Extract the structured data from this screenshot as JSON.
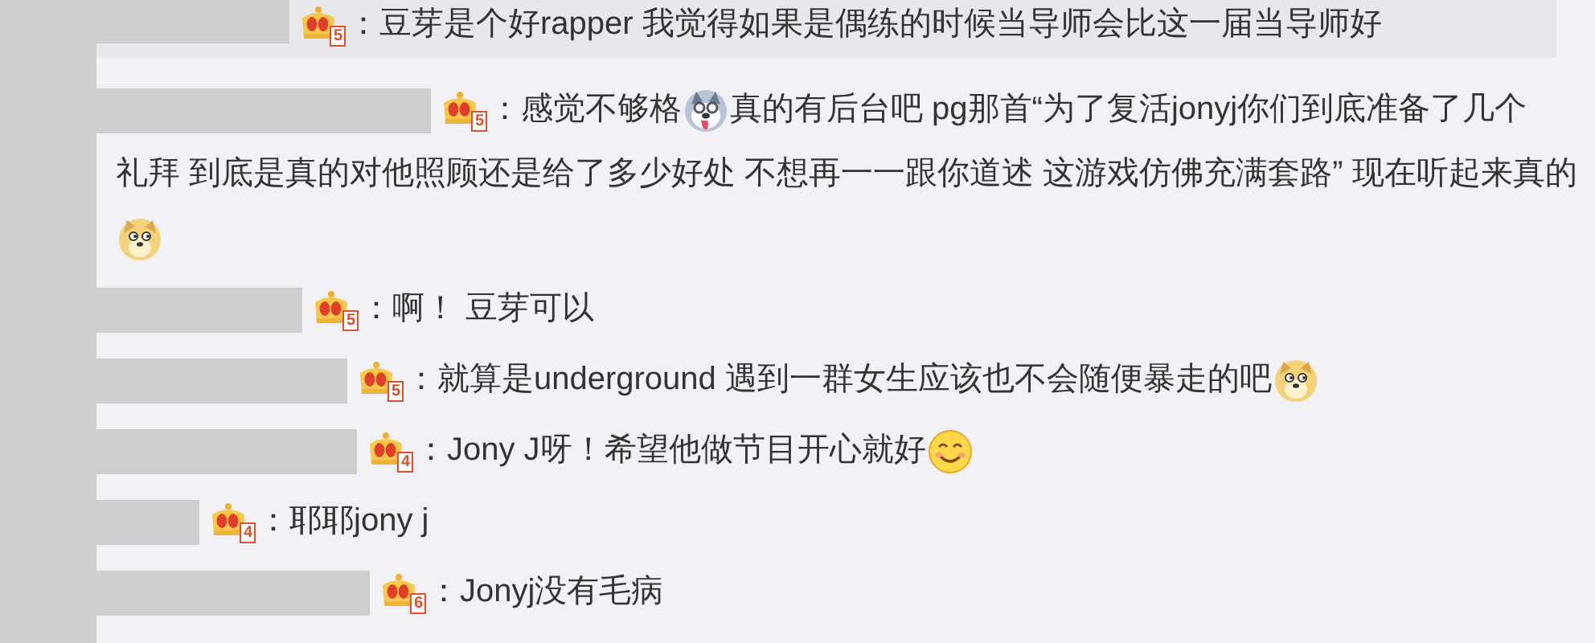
{
  "comments": [
    {
      "level": "5",
      "highlighted": true,
      "segments": [
        {
          "kind": "text",
          "text": "：豆芽是个好rapper  我觉得如果是偶练的时候当导师会比这一届当导师好"
        }
      ]
    },
    {
      "level": "5",
      "highlighted": false,
      "segments": [
        {
          "kind": "text",
          "text": "：感觉不够格"
        },
        {
          "kind": "husky"
        },
        {
          "kind": "text",
          "text": "真的有后台吧 pg那首“为了复活jonyj你们到底准备了几个"
        },
        {
          "kind": "text",
          "text": "礼拜 到底是真的对他照顾还是给了多少好处 不想再一一跟你道述 这游戏仿佛充满套路” 现在听起"
        },
        {
          "kind": "text",
          "text": "来真的"
        },
        {
          "kind": "doge"
        }
      ]
    },
    {
      "level": "5",
      "highlighted": false,
      "segments": [
        {
          "kind": "text",
          "text": "：啊！  豆芽可以"
        }
      ]
    },
    {
      "level": "5",
      "highlighted": false,
      "segments": [
        {
          "kind": "text",
          "text": "：就算是underground 遇到一群女生应该也不会随便暴走的吧"
        },
        {
          "kind": "doge"
        }
      ]
    },
    {
      "level": "4",
      "highlighted": false,
      "segments": [
        {
          "kind": "text",
          "text": "：Jony J呀！希望他做节目开心就好"
        },
        {
          "kind": "smile"
        }
      ]
    },
    {
      "level": "4",
      "highlighted": false,
      "segments": [
        {
          "kind": "text",
          "text": "：耶耶jony j"
        }
      ]
    },
    {
      "level": "6",
      "highlighted": false,
      "segments": [
        {
          "kind": "text",
          "text": "：Jonyj没有毛病"
        }
      ]
    }
  ]
}
